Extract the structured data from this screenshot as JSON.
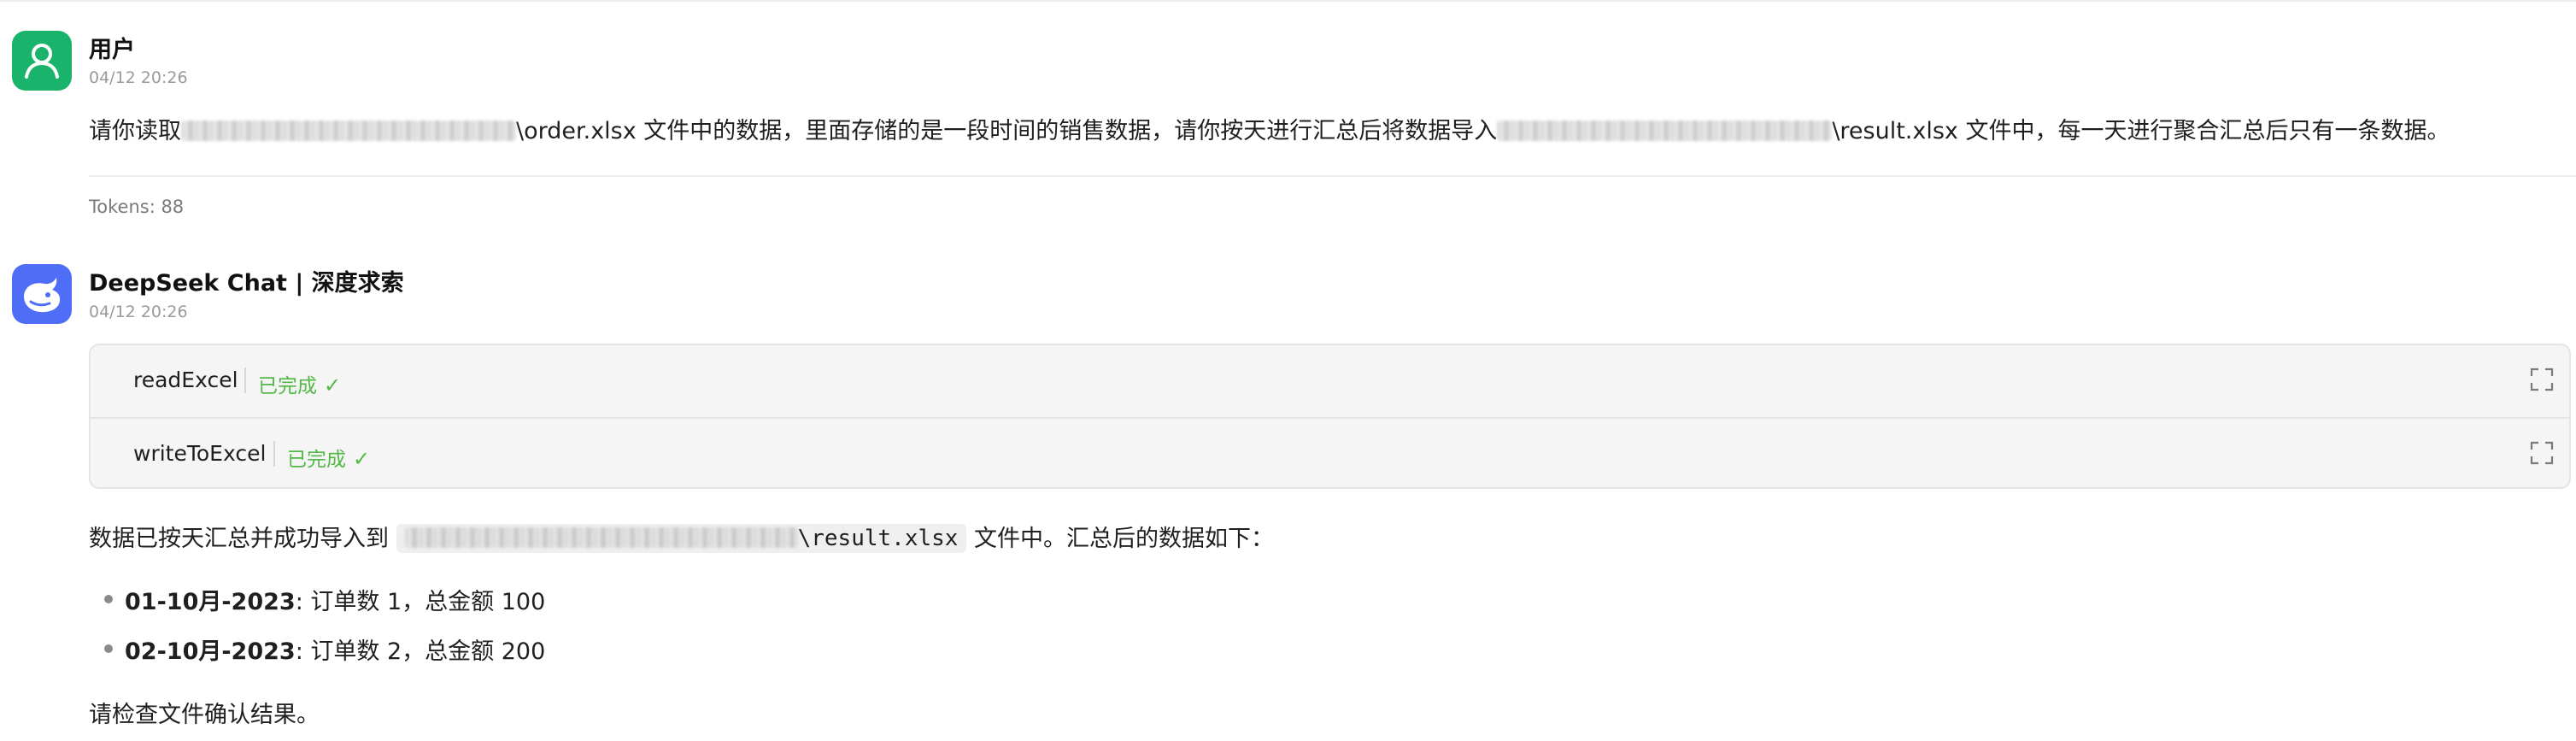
{
  "user_message": {
    "sender": "用户",
    "timestamp": "04/12 20:26",
    "text_part1": "请你读取",
    "text_part2": "\\order.xlsx 文件中的数据，里面存储的是一段时间的销售数据，请你按天进行汇总后将数据导入",
    "text_part3": "\\result.xlsx 文件中，每一天进行聚合汇总后只有一条数据。",
    "tokens": "Tokens: 88"
  },
  "ai_message": {
    "sender": "DeepSeek Chat | 深度求索",
    "timestamp": "04/12 20:26",
    "tools": [
      {
        "name": "readExcel",
        "status": "已完成"
      },
      {
        "name": "writeToExcel",
        "status": "已完成"
      }
    ],
    "summary_part1": "数据已按天汇总并成功导入到",
    "summary_code": "\\result.xlsx",
    "summary_part2": "文件中。汇总后的数据如下：",
    "bullets": [
      {
        "date": "01-10月-2023",
        "detail": ": 订单数 1，总金额 100"
      },
      {
        "date": "02-10月-2023",
        "detail": ": 订单数 2，总金额 200"
      }
    ],
    "closing": "请检查文件确认结果。"
  },
  "colors": {
    "user_avatar": "#19b36b",
    "ai_avatar": "#4f6ef7",
    "status_green": "#52b947"
  },
  "icons": {
    "user_avatar": "user-icon",
    "ai_avatar": "deepseek-whale-icon",
    "status": "check-icon",
    "expand": "expand-icon"
  }
}
